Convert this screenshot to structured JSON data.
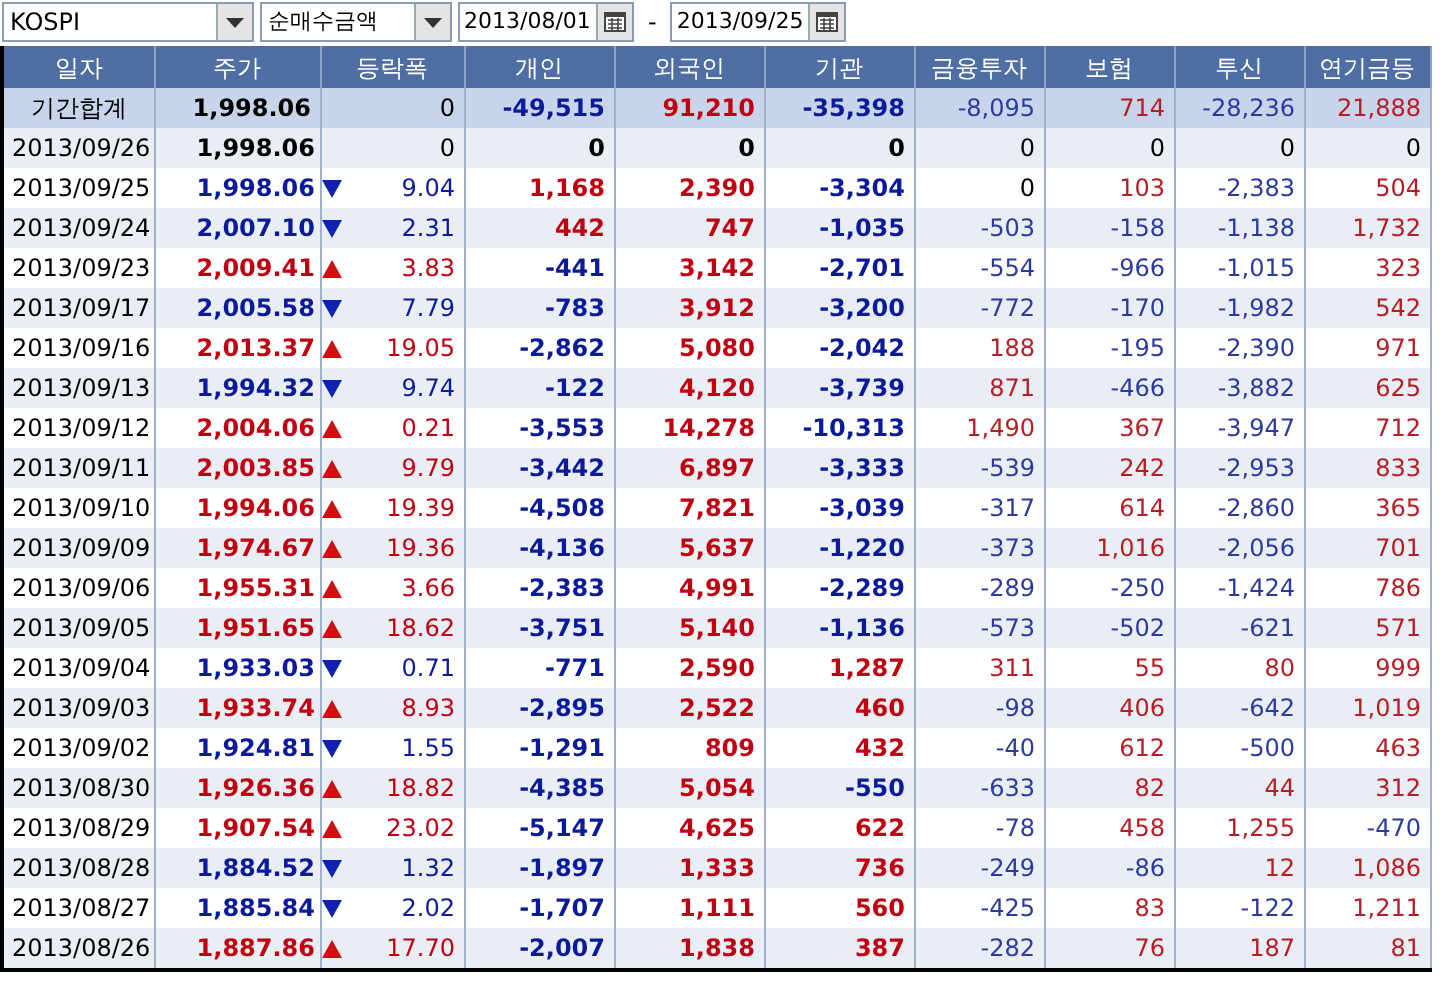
{
  "filters": {
    "market": "KOSPI",
    "measure": "순매수금액",
    "date_from": "2013/08/01",
    "separator": "-",
    "date_to": "2013/09/25"
  },
  "table": {
    "columns": [
      "일자",
      "주가",
      "등락폭",
      "개인",
      "외국인",
      "기관",
      "금융투자",
      "보험",
      "투신",
      "연기금등"
    ],
    "summary": {
      "label": "기간합계",
      "price": "1,998.06",
      "change": "0",
      "values": [
        "-49,515",
        "91,210",
        "-35,398",
        "-8,095",
        "714",
        "-28,236",
        "21,888"
      ]
    },
    "rows": [
      {
        "date": "2013/09/26",
        "kind": "flat",
        "price": "1,998.06",
        "change": "0",
        "values": [
          "0",
          "0",
          "0",
          "0",
          "0",
          "0",
          "0"
        ]
      },
      {
        "date": "2013/09/25",
        "kind": "down",
        "price": "1,998.06",
        "change": "9.04",
        "values": [
          "1,168",
          "2,390",
          "-3,304",
          "0",
          "103",
          "-2,383",
          "504"
        ]
      },
      {
        "date": "2013/09/24",
        "kind": "down",
        "price": "2,007.10",
        "change": "2.31",
        "values": [
          "442",
          "747",
          "-1,035",
          "-503",
          "-158",
          "-1,138",
          "1,732"
        ]
      },
      {
        "date": "2013/09/23",
        "kind": "up",
        "price": "2,009.41",
        "change": "3.83",
        "values": [
          "-441",
          "3,142",
          "-2,701",
          "-554",
          "-966",
          "-1,015",
          "323"
        ]
      },
      {
        "date": "2013/09/17",
        "kind": "down",
        "price": "2,005.58",
        "change": "7.79",
        "values": [
          "-783",
          "3,912",
          "-3,200",
          "-772",
          "-170",
          "-1,982",
          "542"
        ]
      },
      {
        "date": "2013/09/16",
        "kind": "up",
        "price": "2,013.37",
        "change": "19.05",
        "values": [
          "-2,862",
          "5,080",
          "-2,042",
          "188",
          "-195",
          "-2,390",
          "971"
        ]
      },
      {
        "date": "2013/09/13",
        "kind": "down",
        "price": "1,994.32",
        "change": "9.74",
        "values": [
          "-122",
          "4,120",
          "-3,739",
          "871",
          "-466",
          "-3,882",
          "625"
        ]
      },
      {
        "date": "2013/09/12",
        "kind": "up",
        "price": "2,004.06",
        "change": "0.21",
        "values": [
          "-3,553",
          "14,278",
          "-10,313",
          "1,490",
          "367",
          "-3,947",
          "712"
        ]
      },
      {
        "date": "2013/09/11",
        "kind": "up",
        "price": "2,003.85",
        "change": "9.79",
        "values": [
          "-3,442",
          "6,897",
          "-3,333",
          "-539",
          "242",
          "-2,953",
          "833"
        ]
      },
      {
        "date": "2013/09/10",
        "kind": "up",
        "price": "1,994.06",
        "change": "19.39",
        "values": [
          "-4,508",
          "7,821",
          "-3,039",
          "-317",
          "614",
          "-2,860",
          "365"
        ]
      },
      {
        "date": "2013/09/09",
        "kind": "up",
        "price": "1,974.67",
        "change": "19.36",
        "values": [
          "-4,136",
          "5,637",
          "-1,220",
          "-373",
          "1,016",
          "-2,056",
          "701"
        ]
      },
      {
        "date": "2013/09/06",
        "kind": "up",
        "price": "1,955.31",
        "change": "3.66",
        "values": [
          "-2,383",
          "4,991",
          "-2,289",
          "-289",
          "-250",
          "-1,424",
          "786"
        ]
      },
      {
        "date": "2013/09/05",
        "kind": "up",
        "price": "1,951.65",
        "change": "18.62",
        "values": [
          "-3,751",
          "5,140",
          "-1,136",
          "-573",
          "-502",
          "-621",
          "571"
        ]
      },
      {
        "date": "2013/09/04",
        "kind": "down",
        "price": "1,933.03",
        "change": "0.71",
        "values": [
          "-771",
          "2,590",
          "1,287",
          "311",
          "55",
          "80",
          "999"
        ]
      },
      {
        "date": "2013/09/03",
        "kind": "up",
        "price": "1,933.74",
        "change": "8.93",
        "values": [
          "-2,895",
          "2,522",
          "460",
          "-98",
          "406",
          "-642",
          "1,019"
        ]
      },
      {
        "date": "2013/09/02",
        "kind": "down",
        "price": "1,924.81",
        "change": "1.55",
        "values": [
          "-1,291",
          "809",
          "432",
          "-40",
          "612",
          "-500",
          "463"
        ]
      },
      {
        "date": "2013/08/30",
        "kind": "up",
        "price": "1,926.36",
        "change": "18.82",
        "values": [
          "-4,385",
          "5,054",
          "-550",
          "-633",
          "82",
          "44",
          "312"
        ]
      },
      {
        "date": "2013/08/29",
        "kind": "up",
        "price": "1,907.54",
        "change": "23.02",
        "values": [
          "-5,147",
          "4,625",
          "622",
          "-78",
          "458",
          "1,255",
          "-470"
        ]
      },
      {
        "date": "2013/08/28",
        "kind": "down",
        "price": "1,884.52",
        "change": "1.32",
        "values": [
          "-1,897",
          "1,333",
          "736",
          "-249",
          "-86",
          "12",
          "1,086"
        ]
      },
      {
        "date": "2013/08/27",
        "kind": "down",
        "price": "1,885.84",
        "change": "2.02",
        "values": [
          "-1,707",
          "1,111",
          "560",
          "-425",
          "83",
          "-122",
          "1,211"
        ]
      },
      {
        "date": "2013/08/26",
        "kind": "up",
        "price": "1,887.86",
        "change": "17.70",
        "values": [
          "-2,007",
          "1,838",
          "387",
          "-282",
          "76",
          "187",
          "81"
        ]
      }
    ]
  }
}
